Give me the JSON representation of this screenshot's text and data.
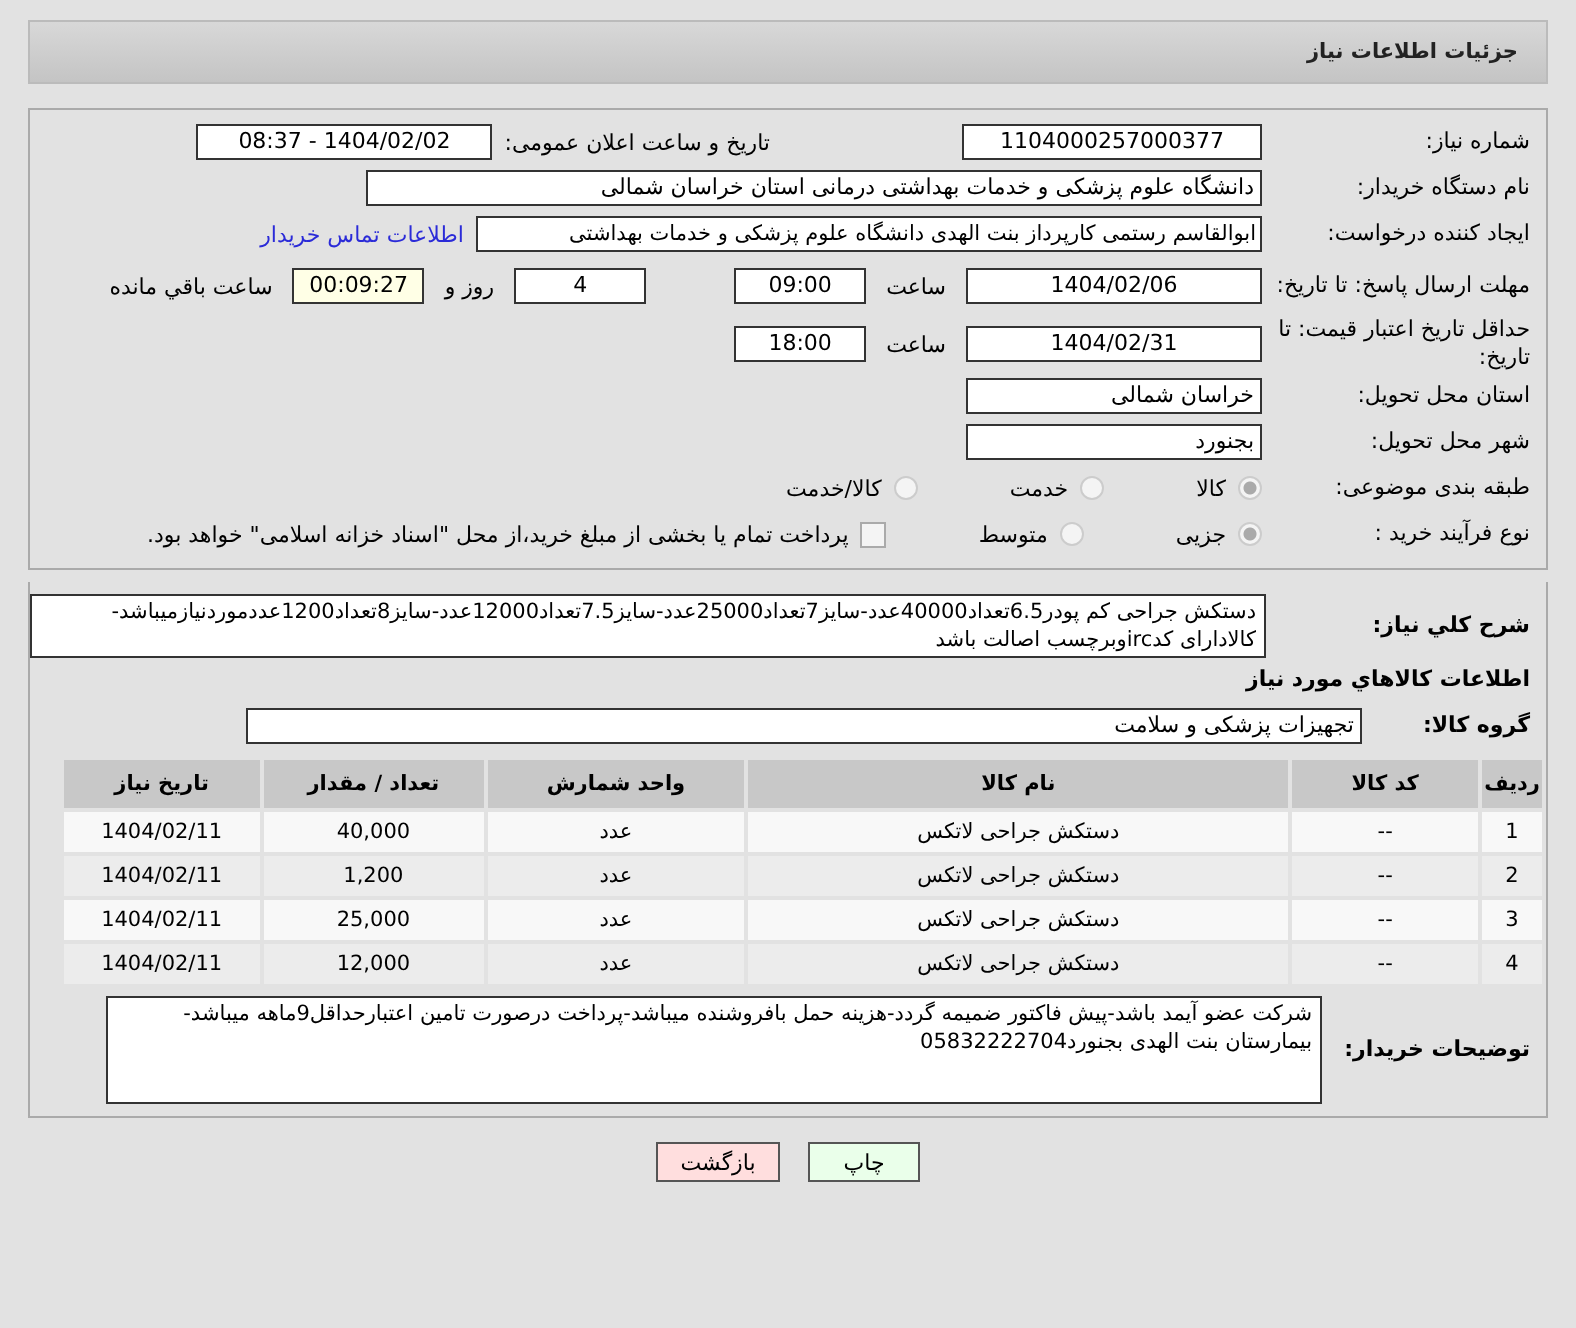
{
  "header": {
    "title": "جزئیات اطلاعات نیاز"
  },
  "need_number": {
    "label": "شماره نیاز:",
    "value": "1104000257000377"
  },
  "announce": {
    "label": "تاریخ و ساعت اعلان عمومی:",
    "value": "1404/02/02 - 08:37"
  },
  "buyer_org": {
    "label": "نام دستگاه خریدار:",
    "value": "دانشگاه علوم پزشکی و خدمات بهداشتی درمانی استان خراسان شمالی"
  },
  "creator": {
    "label": "ایجاد کننده درخواست:",
    "value": "ابوالقاسم رستمی کارپرداز بنت الهدی دانشگاه علوم پزشکی و خدمات بهداشتی",
    "link": "اطلاعات تماس خریدار"
  },
  "reply_deadline": {
    "label": "مهلت ارسال پاسخ: تا تاریخ:",
    "date": "1404/02/06",
    "time_label": "ساعت",
    "time": "09:00",
    "days": "4",
    "days_label": "روز و",
    "remaining": "00:09:27",
    "remaining_label": "ساعت باقي مانده"
  },
  "price_validity": {
    "label": "حداقل تاریخ اعتبار قیمت: تا تاریخ:",
    "date": "1404/02/31",
    "time_label": "ساعت",
    "time": "18:00"
  },
  "province": {
    "label": "استان محل تحویل:",
    "value": "خراسان شمالی"
  },
  "city": {
    "label": "شهر محل تحویل:",
    "value": "بجنورد"
  },
  "category": {
    "label": "طبقه بندی موضوعی:",
    "options": [
      {
        "label": "کالا",
        "selected": true
      },
      {
        "label": "خدمت",
        "selected": false
      },
      {
        "label": "کالا/خدمت",
        "selected": false
      }
    ]
  },
  "purchase_type": {
    "label": "نوع فرآیند خرید :",
    "options": [
      {
        "label": "جزیی",
        "selected": true
      },
      {
        "label": "متوسط",
        "selected": false
      }
    ],
    "payment": {
      "label": "پرداخت تمام یا بخشی از مبلغ خرید،از محل \"اسناد خزانه اسلامی\" خواهد بود.",
      "checked": false
    }
  },
  "description": {
    "label": "شرح کلي نياز:",
    "value": "دستکش جراحی کم پودر6.5تعداد40000عدد-سایز7تعداد25000عدد-سایز7.5تعداد12000عدد-سایز8تعداد1200عددموردنیازمیباشد-کالادارای کدircوبرچسب اصالت باشد"
  },
  "goods_title": "اطلاعات کالاهاي مورد نياز",
  "goods_group": {
    "label": "گروه کالا:",
    "value": "تجهیزات پزشکی و سلامت"
  },
  "table": {
    "columns": [
      "ردیف",
      "کد کالا",
      "نام کالا",
      "واحد شمارش",
      "تعداد / مقدار",
      "تاریخ نیاز"
    ],
    "rows": [
      [
        "1",
        "--",
        "دستکش جراحی لاتکس",
        "عدد",
        "40,000",
        "1404/02/11"
      ],
      [
        "2",
        "--",
        "دستکش جراحی لاتکس",
        "عدد",
        "1,200",
        "1404/02/11"
      ],
      [
        "3",
        "--",
        "دستکش جراحی لاتکس",
        "عدد",
        "25,000",
        "1404/02/11"
      ],
      [
        "4",
        "--",
        "دستکش جراحی لاتکس",
        "عدد",
        "12,000",
        "1404/02/11"
      ]
    ]
  },
  "buyer_notes": {
    "label": "توضیحات خریدار:",
    "value": "شرکت عضو آیمد باشد-پیش فاکتور ضمیمه گردد-هزینه حمل بافروشنده میباشد-پرداخت درصورت تامین اعتبارحداقل9ماهه میباشد-بیمارستان بنت الهدی بجنورد05832222704"
  },
  "buttons": [
    {
      "label": "چاپ",
      "kind": "print"
    },
    {
      "label": "بازگشت",
      "kind": "back"
    }
  ]
}
